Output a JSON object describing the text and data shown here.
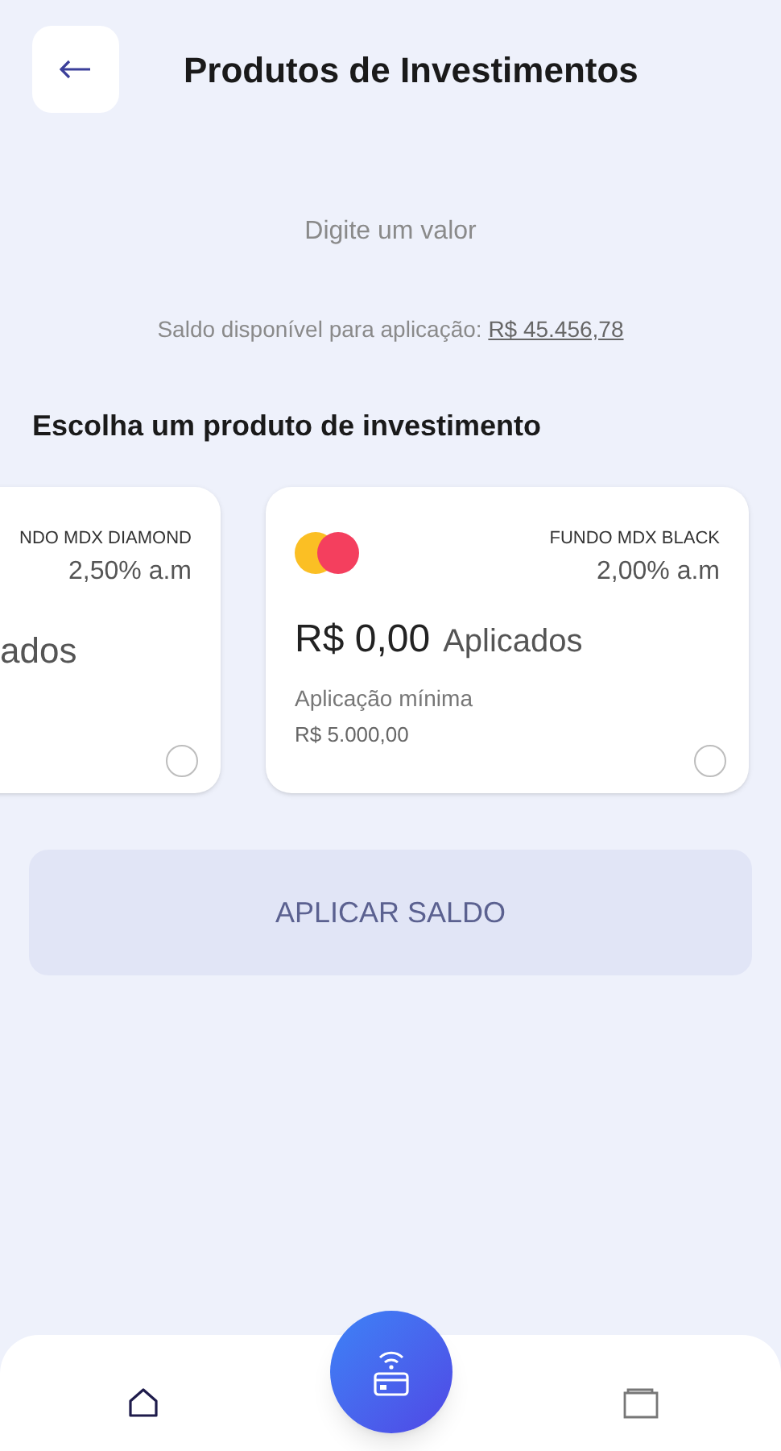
{
  "header": {
    "title": "Produtos de Investimentos"
  },
  "amount": {
    "placeholder": "Digite um valor"
  },
  "balance": {
    "label": "Saldo disponível para aplicação:",
    "value": "R$ 45.456,78"
  },
  "section_title": "Escolha um produto de investimento",
  "products": [
    {
      "kind": "partial",
      "name": "NDO MDX DIAMOND",
      "rate": "2,50% a.m",
      "applied_suffix": "ados",
      "selected": false
    },
    {
      "kind": "full",
      "name": "FUNDO MDX BLACK",
      "rate": "2,00% a.m",
      "applied_amount": "R$ 0,00",
      "applied_suffix": "Aplicados",
      "min_label": "Aplicação mínima",
      "min_value": "R$ 5.000,00",
      "selected": false
    }
  ],
  "apply_button": {
    "label": "APLICAR SALDO",
    "disabled": true
  }
}
